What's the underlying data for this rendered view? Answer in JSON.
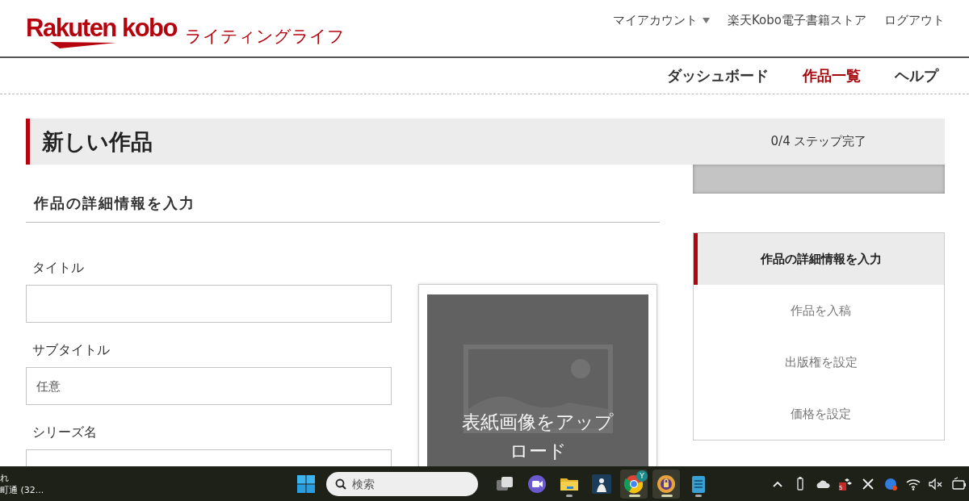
{
  "header": {
    "logo": "Rakuten kobo",
    "logo_subtitle": "ライティングライフ",
    "top_links": [
      {
        "label": "マイアカウント",
        "dropdown": true
      },
      {
        "label": "楽天Kobo電子書籍ストア",
        "dropdown": false
      },
      {
        "label": "ログアウト",
        "dropdown": false
      }
    ]
  },
  "nav": [
    {
      "label": "ダッシュボード",
      "selected": false
    },
    {
      "label": "作品一覧",
      "selected": true
    },
    {
      "label": "ヘルプ",
      "selected": false
    }
  ],
  "page": {
    "title": "新しい作品",
    "progress_text": "0/4 ステップ完了",
    "progress": {
      "level": 0
    }
  },
  "section_title": "作品の詳細情報を入力",
  "fields": [
    {
      "label": "タイトル"
    },
    {
      "label": "サブタイトル",
      "placeholder": "任意"
    },
    {
      "label": "シリーズ名"
    }
  ],
  "cover": {
    "label": "表紙画像をアップロード"
  },
  "steps": [
    {
      "label": "作品の詳細情報を入力",
      "selected": true
    },
    {
      "label": "作品を入稿",
      "selected": false
    },
    {
      "label": "出版権を設定",
      "selected": false
    },
    {
      "label": "価格を設定",
      "selected": false
    }
  ],
  "taskbar": {
    "weather": [
      "れ",
      "町通 (32..."
    ],
    "search": {
      "placeholder": "検索"
    },
    "apps": [
      {
        "kind": "taskview",
        "running": false,
        "selected": false
      },
      {
        "kind": "meet",
        "running": false,
        "selected": false
      },
      {
        "kind": "folder",
        "running": true,
        "selected": false
      },
      {
        "kind": "reader",
        "running": false,
        "selected": false
      },
      {
        "kind": "browser",
        "running": true,
        "selected": true,
        "badge": "Y"
      },
      {
        "kind": "vpn",
        "running": true,
        "selected": true
      },
      {
        "kind": "notepad",
        "running": true,
        "selected": false
      }
    ],
    "tray": [
      {
        "kind": "chevron"
      },
      {
        "kind": "usb"
      },
      {
        "kind": "cloud"
      },
      {
        "kind": "box",
        "badge": "5"
      },
      {
        "kind": "close"
      },
      {
        "kind": "dot"
      },
      {
        "kind": "wifi"
      },
      {
        "kind": "mute"
      },
      {
        "kind": "battery"
      }
    ]
  }
}
